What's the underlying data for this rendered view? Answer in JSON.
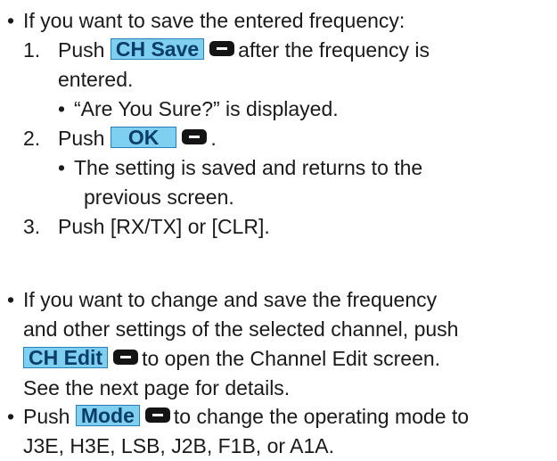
{
  "section1": {
    "intro": "If you want to save the entered frequency:",
    "step1": {
      "num": "1.",
      "pre": "Push",
      "key": "CH Save",
      "post": "after the frequency is",
      "cont": "entered.",
      "sub": "“Are You Sure?” is displayed."
    },
    "step2": {
      "num": "2.",
      "pre": "Push",
      "key": "OK",
      "post": ".",
      "sub_line1": "The setting is saved and returns to the",
      "sub_line2": "previous screen."
    },
    "step3": {
      "num": "3.",
      "text": "Push [RX/TX] or [CLR]."
    }
  },
  "section2": {
    "line1": "If you want to change and save the frequency",
    "line2": "and other settings of the selected channel, push",
    "key": "CH Edit",
    "line3_post": "to open the Channel Edit screen.",
    "line4": "See the next page for details."
  },
  "section3": {
    "pre": "Push",
    "key": "Mode",
    "post": "to change the operating mode to",
    "line2": "J3E, H3E, LSB, J2B, F1B, or A1A."
  },
  "icons": {
    "bullet": "•",
    "key_button": "softkey-button-icon"
  },
  "colors": {
    "key_fill": "#7fd0f0",
    "key_border": "#2a7fb8",
    "key_text": "#0b3d6b",
    "text": "#1a1a1a"
  }
}
